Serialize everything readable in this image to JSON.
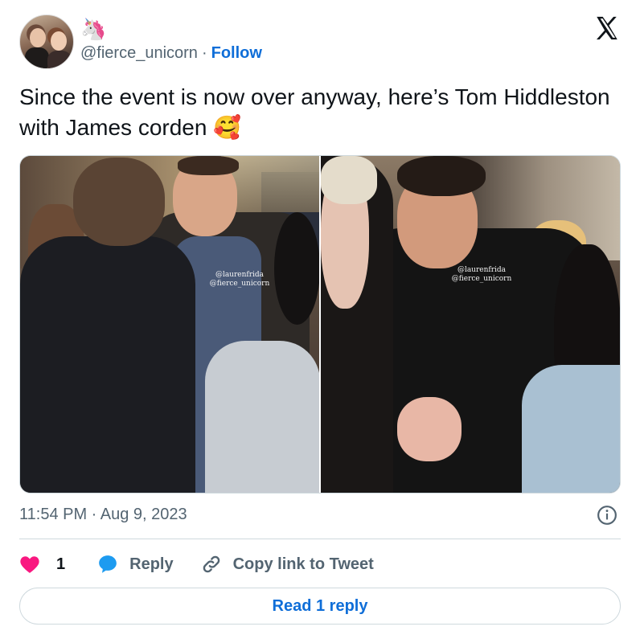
{
  "author": {
    "display_name": "🦄",
    "handle": "@fierce_unicorn",
    "separator": "·",
    "follow_label": "Follow"
  },
  "tweet": {
    "text": "Since the event is now over anyway, here’s Tom Hiddleston with James corden 🥰",
    "timestamp": "11:54 PM · Aug 9, 2023"
  },
  "media": {
    "left_watermark": [
      "@laurenfrida",
      "@fierce_unicorn"
    ],
    "right_watermark": [
      "@laurenfrida",
      "@fierce_unicorn"
    ]
  },
  "actions": {
    "like_count": "1",
    "reply_label": "Reply",
    "copy_label": "Copy link to Tweet"
  },
  "read_replies_label": "Read 1 reply",
  "colors": {
    "link": "#0f6ed8",
    "like": "#f91880",
    "reply_icon": "#1d9bf0",
    "muted": "#536471",
    "border": "#cfd9de"
  },
  "icons": {
    "logo": "x-logo-icon",
    "info": "info-icon",
    "like": "heart-icon",
    "reply": "speech-bubble-icon",
    "copy": "link-icon"
  }
}
